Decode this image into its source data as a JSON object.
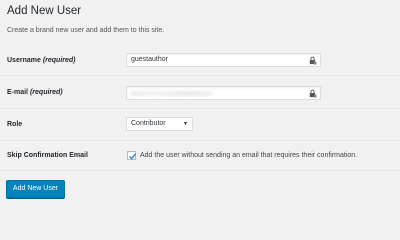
{
  "header": {
    "title": "Add New User",
    "description": "Create a brand new user and add them to this site."
  },
  "form": {
    "username": {
      "label": "Username",
      "required": "(required)",
      "value": "guestauthor"
    },
    "email": {
      "label": "E-mail",
      "required": "(required)",
      "value": ""
    },
    "role": {
      "label": "Role",
      "selected": "Contributor",
      "caret": "▼"
    },
    "skip_confirmation": {
      "label": "Skip Confirmation Email",
      "checked": true,
      "checkbox_label": "Add the user without sending an email that requires their confirmation."
    },
    "submit_label": "Add New User"
  },
  "icons": {
    "field_icon": "lock-icon",
    "checkbox": "checkmark-icon"
  },
  "colors": {
    "background": "#f1f1f1",
    "button": "#0085ba",
    "check": "#1e8cbe"
  }
}
